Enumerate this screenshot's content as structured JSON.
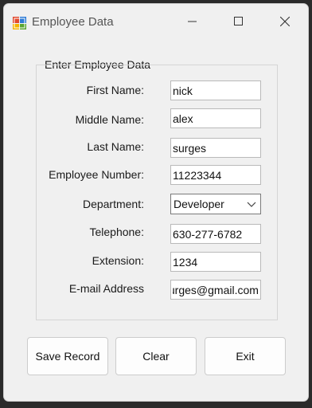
{
  "window": {
    "title": "Employee Data",
    "icon": "form-app-icon"
  },
  "group": {
    "title": "Enter Employee Data"
  },
  "fields": {
    "first_name": {
      "label": "First Name:",
      "value": "nick"
    },
    "middle_name": {
      "label": "Middle Name:",
      "value": "alex"
    },
    "last_name": {
      "label": "Last Name:",
      "value": "surges"
    },
    "employee_number": {
      "label": "Employee Number:",
      "value": "11223344"
    },
    "department": {
      "label": "Department:",
      "value": "Developer"
    },
    "telephone": {
      "label": "Telephone:",
      "value": "630-277-6782"
    },
    "extension": {
      "label": "Extension:",
      "value": "1234"
    },
    "email": {
      "label": "E-mail Address",
      "value": "nicksurges@gmail.com"
    }
  },
  "buttons": {
    "save": "Save Record",
    "clear": "Clear",
    "exit": "Exit"
  },
  "colors": {
    "window_bg": "#f0f0f0",
    "input_bg": "#ffffff",
    "text": "#111111"
  }
}
